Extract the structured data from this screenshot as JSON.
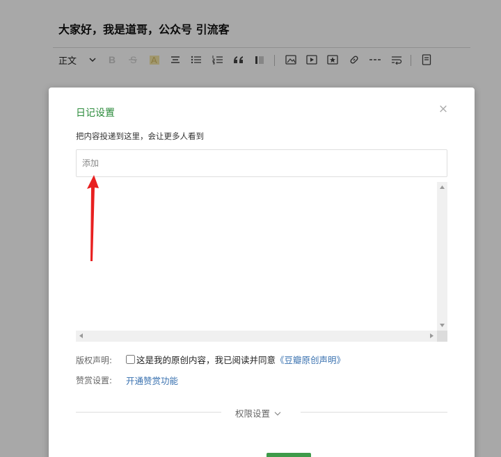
{
  "editor": {
    "title": "大家好，我是道哥，公众号 引流客",
    "format_label": "正文",
    "toolbar_icons": [
      "bold-icon",
      "strikethrough-icon",
      "highlight-icon",
      "align-center-icon",
      "bullet-list-icon",
      "numbered-list-icon",
      "quote-icon",
      "code-block-icon",
      "image-icon",
      "video-icon",
      "star-icon",
      "link-icon",
      "divider-icon",
      "wrap-icon",
      "document-icon"
    ]
  },
  "dialog": {
    "title": "日记设置",
    "description": "把内容投递到这里，会让更多人看到",
    "add_placeholder": "添加",
    "copyright": {
      "label": "版权声明:",
      "checkbox_text": "这是我的原创内容，我已阅读并同意",
      "link_text": "《豆瓣原创声明》"
    },
    "reward": {
      "label": "赞赏设置:",
      "link_text": "开通赞赏功能"
    },
    "permission_label": "权限设置"
  },
  "colors": {
    "title_green": "#2a8a3a",
    "link_blue": "#3a72b0",
    "primary_green": "#3e9a4a",
    "annotation_red": "#e82020"
  }
}
